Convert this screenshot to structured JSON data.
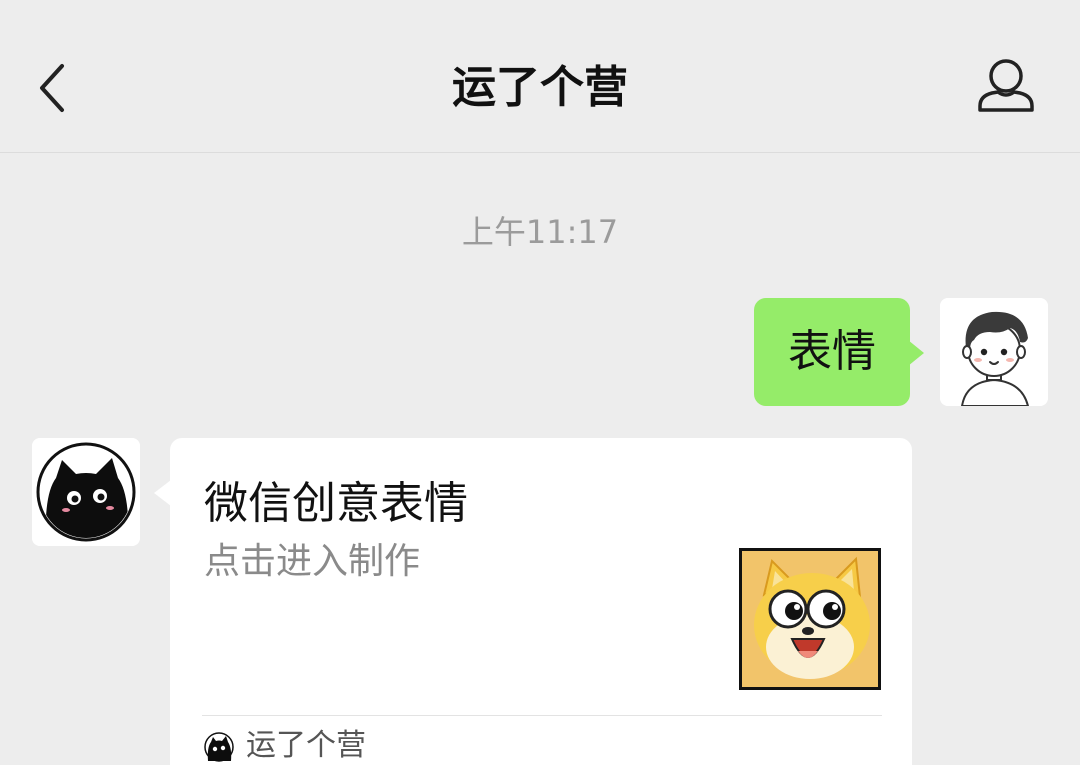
{
  "header": {
    "title": "运了个营",
    "back_icon": "chevron-left-icon",
    "profile_icon": "user-icon"
  },
  "timestamp": "上午11:17",
  "messages": {
    "outgoing": {
      "text": "表情",
      "bubble_color": "#95ec69"
    },
    "incoming_card": {
      "title": "微信创意表情",
      "subtitle": "点击进入制作",
      "source_name": "运了个营"
    }
  },
  "colors": {
    "background": "#ededed",
    "bubble_green": "#95ec69",
    "card": "#ffffff"
  }
}
